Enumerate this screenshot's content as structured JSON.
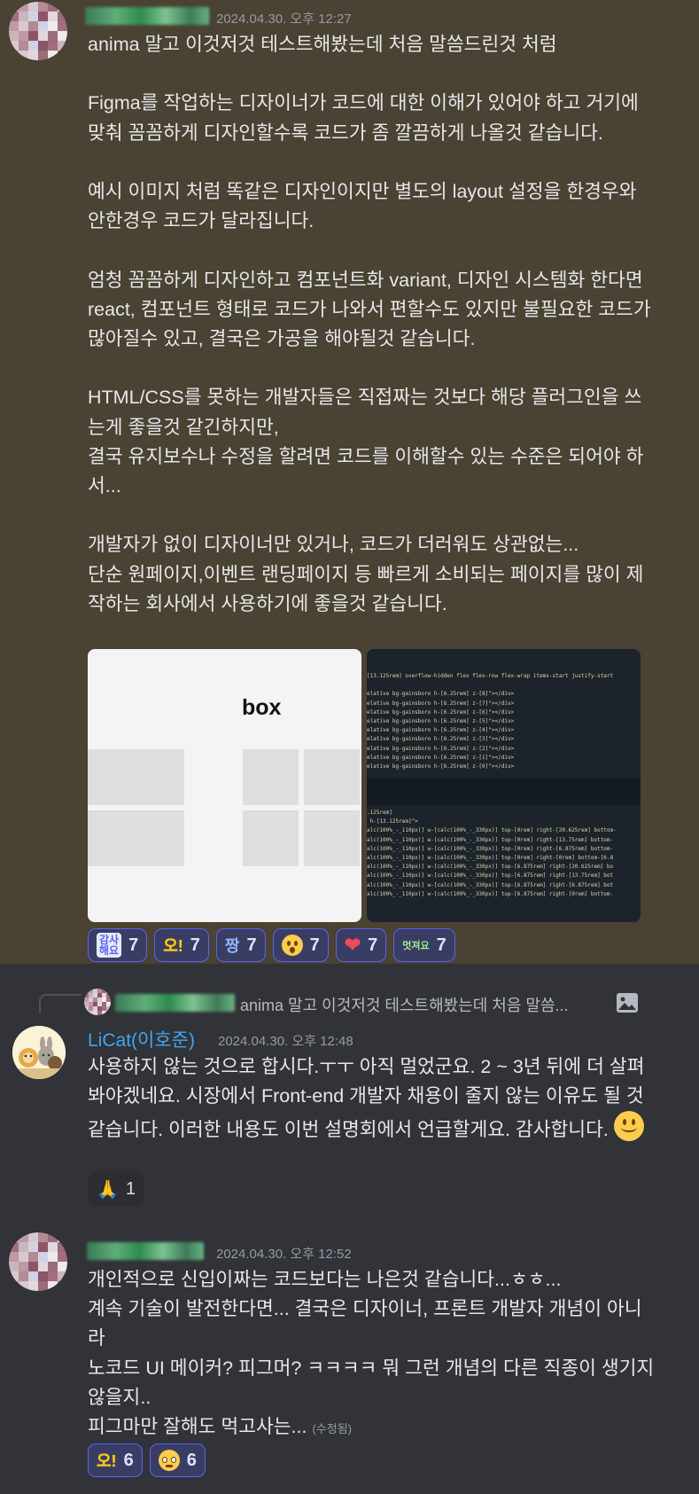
{
  "messages": [
    {
      "timestamp": "2024.04.30. 오후 12:27",
      "text": "anima 말고 이것저것 테스트해봤는데 처음 말씀드린것 처럼\n\nFigma를 작업하는 디자이너가 코드에 대한 이해가 있어야 하고 거기에 맞춰 꼼꼼하게 디자인할수록 코드가 좀 깔끔하게 나올것 같습니다.\n\n예시 이미지 처럼 똑같은 디자인이지만 별도의 layout 설정을 한경우와 안한경우 코드가 달라집니다.\n\n엄청 꼼꼼하게 디자인하고 컴포넌트화 variant, 디자인 시스템화 한다면 react, 컴포넌트 형태로 코드가 나와서 편할수도 있지만 불필요한 코드가 많아질수 있고, 결국은 가공을 해야될것 같습니다.\n\nHTML/CSS를 못하는 개발자들은 직접짜는 것보다 해당 플러그인을 쓰는게 좋을것 같긴하지만,\n결국 유지보수나 수정을 할려면 코드를 이해할수 있는 수준은 되어야 하서...\n\n개발자가 없이 디자이너만 있거나, 코드가 더러워도 상관없는...\n단순 원페이지,이벤트 랜딩페이지 등 빠르게 소비되는 페이지를 많이 제작하는 회사에서 사용하기에 좋을것 같습니다.",
      "attachment_left_label": "box",
      "attachment_right_code_top": [
        "[13.125rem] overflow-hidden flex flex-row flex-wrap items-start justify-start",
        "",
        "elative bg-gainsboro h-[6.25rem] z-[8]\"></div>",
        "elative bg-gainsboro h-[6.25rem] z-[7]\"></div>",
        "elative bg-gainsboro h-[6.25rem] z-[6]\"></div>",
        "elative bg-gainsboro h-[6.25rem] z-[5]\"></div>",
        "elative bg-gainsboro h-[6.25rem] z-[4]\"></div>",
        "elative bg-gainsboro h-[6.25rem] z-[3]\"></div>",
        "elative bg-gainsboro h-[6.25rem] z-[2]\"></div>",
        "elative bg-gainsboro h-[6.25rem] z-[1]\"></div>",
        "elative bg-gainsboro h-[6.25rem] z-[0]\"></div>"
      ],
      "attachment_right_code_bottom": [
        ".125rem]",
        " h-[13.125rem]\">",
        "alc(100%_-_110px)] w-[calc(100%_-_330px)] top-[0rem] right-[20.625rem] bottom-",
        "alc(100%_-_110px)] w-[calc(100%_-_330px)] top-[0rem] right-[13.75rem] bottom-",
        "alc(100%_-_110px)] w-[calc(100%_-_330px)] top-[0rem] right-[6.875rem] bottom-",
        "alc(100%_-_110px)] w-[calc(100%_-_330px)] top-[0rem] right-[0rem] bottom-[6.8",
        "alc(100%_-_110px)] w-[calc(100%_-_330px)] top-[6.875rem] right-[20.625rem] bo",
        "alc(100%_-_110px)] w-[calc(100%_-_330px)] top-[6.875rem] right-[13.75rem] bot",
        "alc(100%_-_110px)] w-[calc(100%_-_330px)] top-[6.875rem] right-[6.875rem] bot",
        "alc(100%_-_110px)] w-[calc(100%_-_330px)] top-[6.875rem] right-[0rem] bottom-"
      ],
      "reactions": [
        {
          "icon": "thanks-badge-icon",
          "label": "감사\n해요",
          "count": "7"
        },
        {
          "icon": "oh-text-icon",
          "label": "오!",
          "count": "7"
        },
        {
          "icon": "jjang-text-icon",
          "label": "짱",
          "count": "7"
        },
        {
          "icon": "surprised-face-icon",
          "label": "",
          "count": "7"
        },
        {
          "icon": "heart-icon",
          "label": "",
          "count": "7"
        },
        {
          "icon": "cool-badge-icon",
          "label": "멋져요",
          "count": "7"
        }
      ]
    },
    {
      "reply_preview": "anima 말고 이것저것 테스트해봤는데 처음 말씀...",
      "author": "LiCat(이호준)",
      "author_color": "#3ea6f2",
      "timestamp": "2024.04.30. 오후 12:48",
      "text": "사용하지 않는 것으로 합시다.ㅜㅜ 아직 멀었군요. 2 ~ 3년 뒤에 더 살펴봐야겠네요. 시장에서 Front-end 개발자 채용이 줄지 않는 이유도 될 것 같습니다. 이러한 내용도 이번 설명회에서 언급할게요. 감사합니다.",
      "reactions": [
        {
          "icon": "folded-hands-icon",
          "label": "",
          "count": "1"
        }
      ]
    },
    {
      "timestamp": "2024.04.30. 오후 12:52",
      "text": "개인적으로 신입이짜는 코드보다는 나은것 같습니다...ㅎㅎ...\n계속 기술이 발전한다면... 결국은 디자이너, 프론트 개발자 개념이 아니라\n노코드 UI 메이커? 피그머? ㅋㅋㅋㅋ 뭐 그런 개념의 다른 직종이 생기지 않을지..\n피그마만 잘해도 먹고사는...",
      "edited_label": "(수정됨)",
      "reactions": [
        {
          "icon": "oh-text-icon",
          "label": "오!",
          "count": "6"
        },
        {
          "icon": "pleading-face-icon",
          "label": "",
          "count": "6"
        }
      ]
    }
  ],
  "colors": {
    "highlight_bg": "#4a4232",
    "base_bg": "#313338",
    "reaction_accent": "#5865f2"
  }
}
